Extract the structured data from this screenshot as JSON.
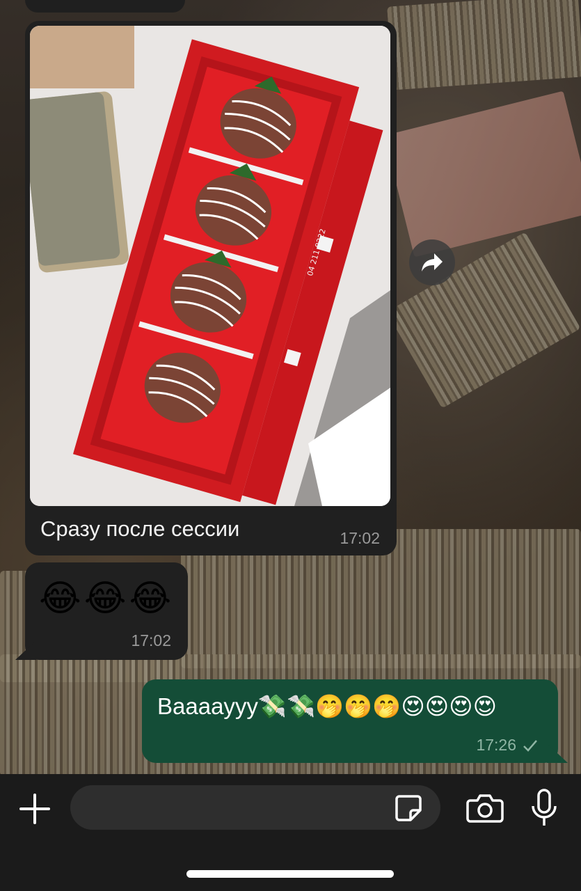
{
  "chat": {
    "messages": [
      {
        "direction": "incoming",
        "type": "photo",
        "caption": "Сразу после сессии",
        "time": "17:02"
      },
      {
        "direction": "incoming",
        "type": "text",
        "text": "😂😂😂",
        "time": "17:02"
      },
      {
        "direction": "outgoing",
        "type": "text",
        "text": "Baaaayyy💸💸🤭🤭🤭😍😍😍😍",
        "time": "17:26",
        "status": "sent-check"
      }
    ],
    "photo_box_text": "04 211 8222"
  },
  "input_bar": {
    "placeholder": "",
    "icons": [
      "plus-icon",
      "sticker-icon",
      "camera-icon",
      "microphone-icon"
    ]
  },
  "colors": {
    "incoming_bubble": "#202020",
    "outgoing_bubble": "#144d37",
    "input_bar": "#1b1b1b"
  }
}
